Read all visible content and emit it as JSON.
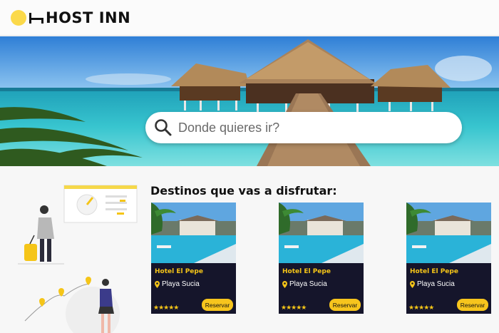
{
  "brand": {
    "name": "HOST INN",
    "accent": "#fbd94a"
  },
  "search": {
    "placeholder": "Donde quieres ir?"
  },
  "section": {
    "title": "Destinos que vas a disfrutar:"
  },
  "cards": [
    {
      "title": "Hotel El Pepe",
      "location": "Playa Sucia",
      "rating": 5,
      "stars": "★★★★★",
      "button": "Reservar"
    },
    {
      "title": "Hotel El Pepe",
      "location": "Playa Sucia",
      "rating": 5,
      "stars": "★★★★★",
      "button": "Reservar"
    },
    {
      "title": "Hotel El Pepe",
      "location": "Playa Sucia",
      "rating": 5,
      "stars": "★★★★★",
      "button": "Reservar"
    }
  ]
}
